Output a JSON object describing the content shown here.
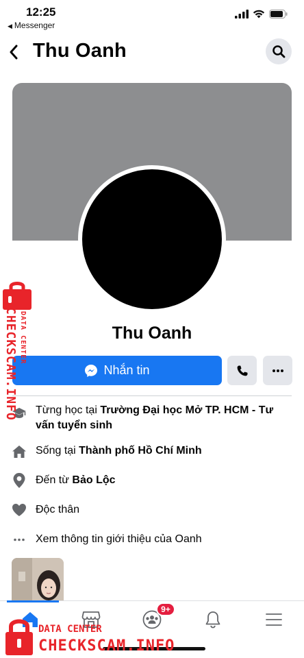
{
  "status_bar": {
    "time": "12:25",
    "back_app": "Messenger"
  },
  "header": {
    "title": "Thu Oanh"
  },
  "profile": {
    "name": "Thu Oanh",
    "message_button": "Nhắn tin"
  },
  "about": {
    "education_prefix": "Từng học tại ",
    "education_value": "Trường Đại học Mở TP. HCM - Tư vấn tuyển sinh",
    "lives_prefix": "Sống tại ",
    "lives_value": "Thành phố Hồ Chí Minh",
    "from_prefix": "Đến từ ",
    "from_value": "Bảo Lộc",
    "relationship": "Độc thân",
    "see_more": "Xem thông tin giới thiệu của Oanh"
  },
  "tabbar": {
    "items": [
      "home-icon",
      "marketplace-icon",
      "groups-icon",
      "notifications-icon",
      "menu-icon"
    ],
    "groups_badge": "9+",
    "active_color": "#1877f2"
  },
  "watermark": {
    "data_center": "DATA CENTER",
    "brand": "CHECKSCAM.INFO",
    "color": "#e8242a"
  },
  "colors": {
    "primary": "#1877f2",
    "cover": "#8d8e90",
    "badge": "#e41e3f"
  }
}
